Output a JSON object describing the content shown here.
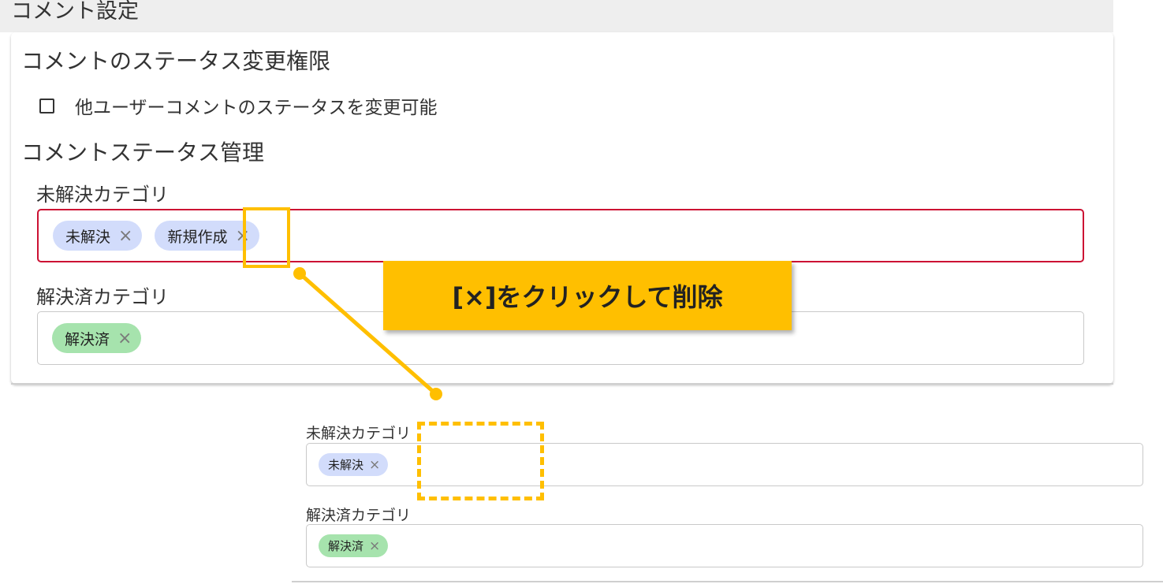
{
  "header": {
    "title": "コメント設定"
  },
  "status_permission": {
    "heading": "コメントのステータス変更権限",
    "checkbox_label": "他ユーザーコメントのステータスを変更可能",
    "checked": false
  },
  "status_management": {
    "heading": "コメントステータス管理",
    "unresolved": {
      "label": "未解決カテゴリ",
      "chips": [
        "未解決",
        "新規作成"
      ]
    },
    "resolved": {
      "label": "解決済カテゴリ",
      "chips": [
        "解決済"
      ]
    }
  },
  "callout": {
    "text": "[×]をクリックして削除"
  },
  "after": {
    "unresolved": {
      "label": "未解決カテゴリ",
      "chips": [
        "未解決"
      ]
    },
    "resolved": {
      "label": "解決済カテゴリ",
      "chips": [
        "解決済"
      ]
    }
  },
  "icons": {
    "chip_remove": "×"
  },
  "colors": {
    "accent": "#ffbf00",
    "error_border": "#cc1133",
    "chip_unresolved": "#d2dcfb",
    "chip_resolved": "#a6e3ad"
  }
}
